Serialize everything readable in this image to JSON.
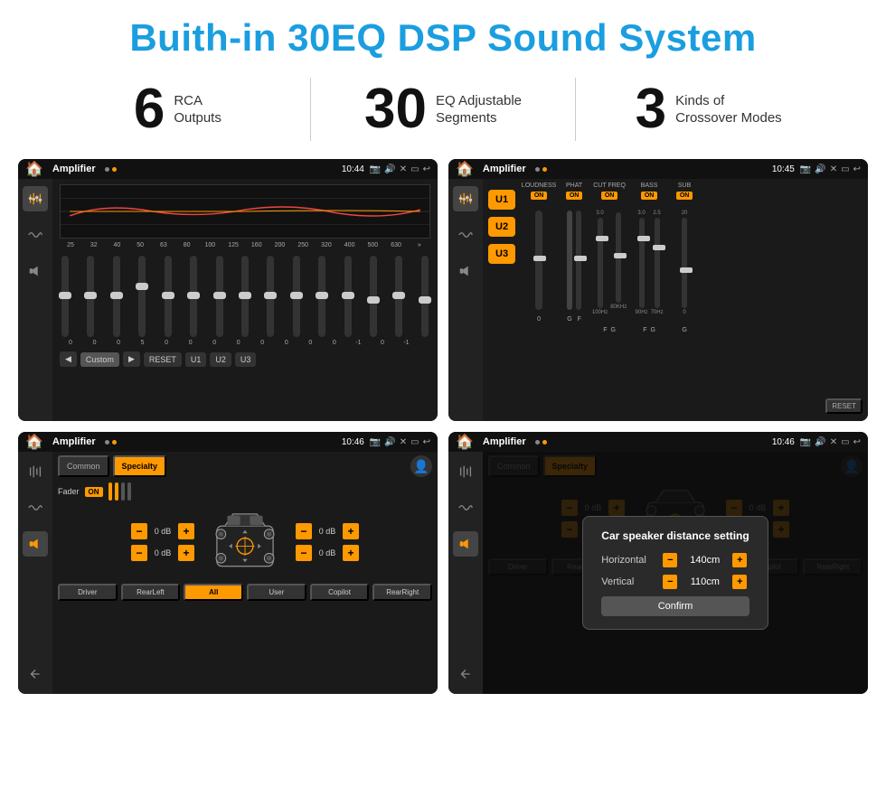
{
  "header": {
    "title": "Buith-in 30EQ DSP Sound System"
  },
  "stats": [
    {
      "number": "6",
      "label": "RCA\nOutputs"
    },
    {
      "number": "30",
      "label": "EQ Adjustable\nSegments"
    },
    {
      "number": "3",
      "label": "Kinds of\nCrossover Modes"
    }
  ],
  "panels": [
    {
      "id": "panel1",
      "app_title": "Amplifier",
      "time": "10:44",
      "eq_freqs": [
        "25",
        "32",
        "40",
        "50",
        "63",
        "80",
        "100",
        "125",
        "160",
        "200",
        "250",
        "320",
        "400",
        "500",
        "630"
      ],
      "eq_vals": [
        "0",
        "0",
        "0",
        "5",
        "0",
        "0",
        "0",
        "0",
        "0",
        "0",
        "0",
        "0",
        "-1",
        "0",
        "-1"
      ],
      "preset_label": "Custom",
      "buttons": [
        "◀",
        "Custom",
        "▶",
        "RESET",
        "U1",
        "U2",
        "U3"
      ]
    },
    {
      "id": "panel2",
      "app_title": "Amplifier",
      "time": "10:45",
      "presets": [
        "U1",
        "U2",
        "U3"
      ],
      "channels": [
        {
          "name": "LOUDNESS",
          "on": true
        },
        {
          "name": "PHAT",
          "on": true
        },
        {
          "name": "CUT FREQ",
          "on": true
        },
        {
          "name": "BASS",
          "on": true
        },
        {
          "name": "SUB",
          "on": true
        }
      ],
      "reset_label": "RESET"
    },
    {
      "id": "panel3",
      "app_title": "Amplifier",
      "time": "10:46",
      "tabs": [
        "Common",
        "Specialty"
      ],
      "active_tab": "Specialty",
      "fader_label": "Fader",
      "fader_on": "ON",
      "db_values": [
        "0 dB",
        "0 dB",
        "0 dB",
        "0 dB"
      ],
      "buttons": [
        "Driver",
        "RearLeft",
        "All",
        "User",
        "Copilot",
        "RearRight"
      ]
    },
    {
      "id": "panel4",
      "app_title": "Amplifier",
      "time": "10:46",
      "tabs": [
        "Common",
        "Specialty"
      ],
      "dialog": {
        "title": "Car speaker distance setting",
        "horizontal_label": "Horizontal",
        "horizontal_val": "140cm",
        "vertical_label": "Vertical",
        "vertical_val": "110cm",
        "confirm_label": "Confirm"
      },
      "db_values": [
        "0 dB",
        "0 dB"
      ],
      "buttons": [
        "Driver",
        "RearLeft",
        "All",
        "User",
        "Copilot",
        "RearRight"
      ]
    }
  ]
}
